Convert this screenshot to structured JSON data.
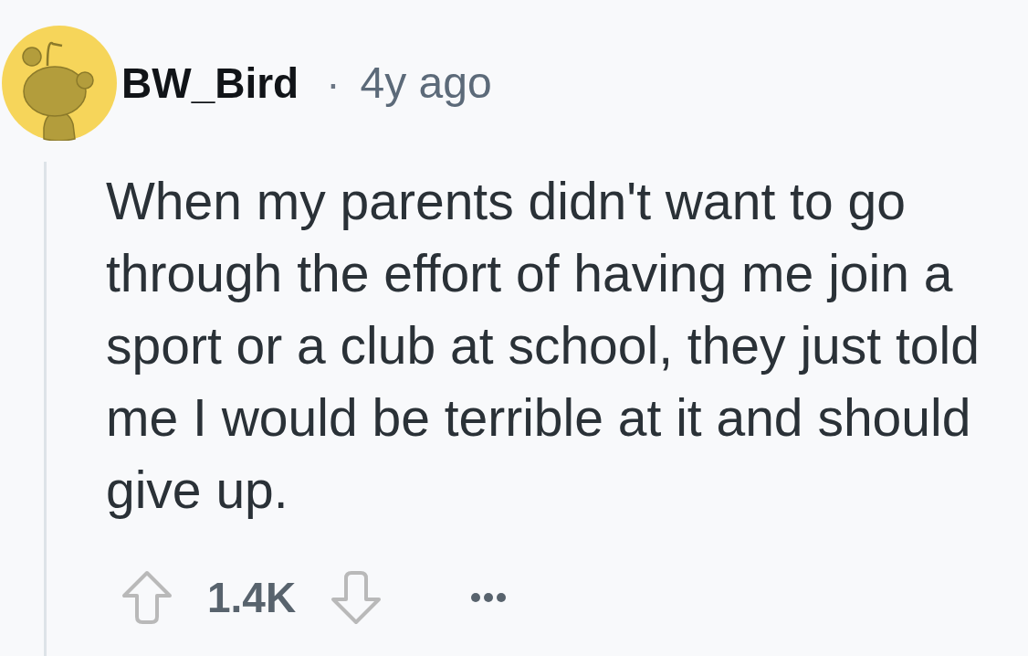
{
  "comment": {
    "author": "BW_Bird",
    "separator": "·",
    "age": "4y ago",
    "body": "When my parents didn't want to go through the effort of having me join a sport or a club at school, they just told me I would be terrible at it and should give up.",
    "score": "1.4K"
  }
}
